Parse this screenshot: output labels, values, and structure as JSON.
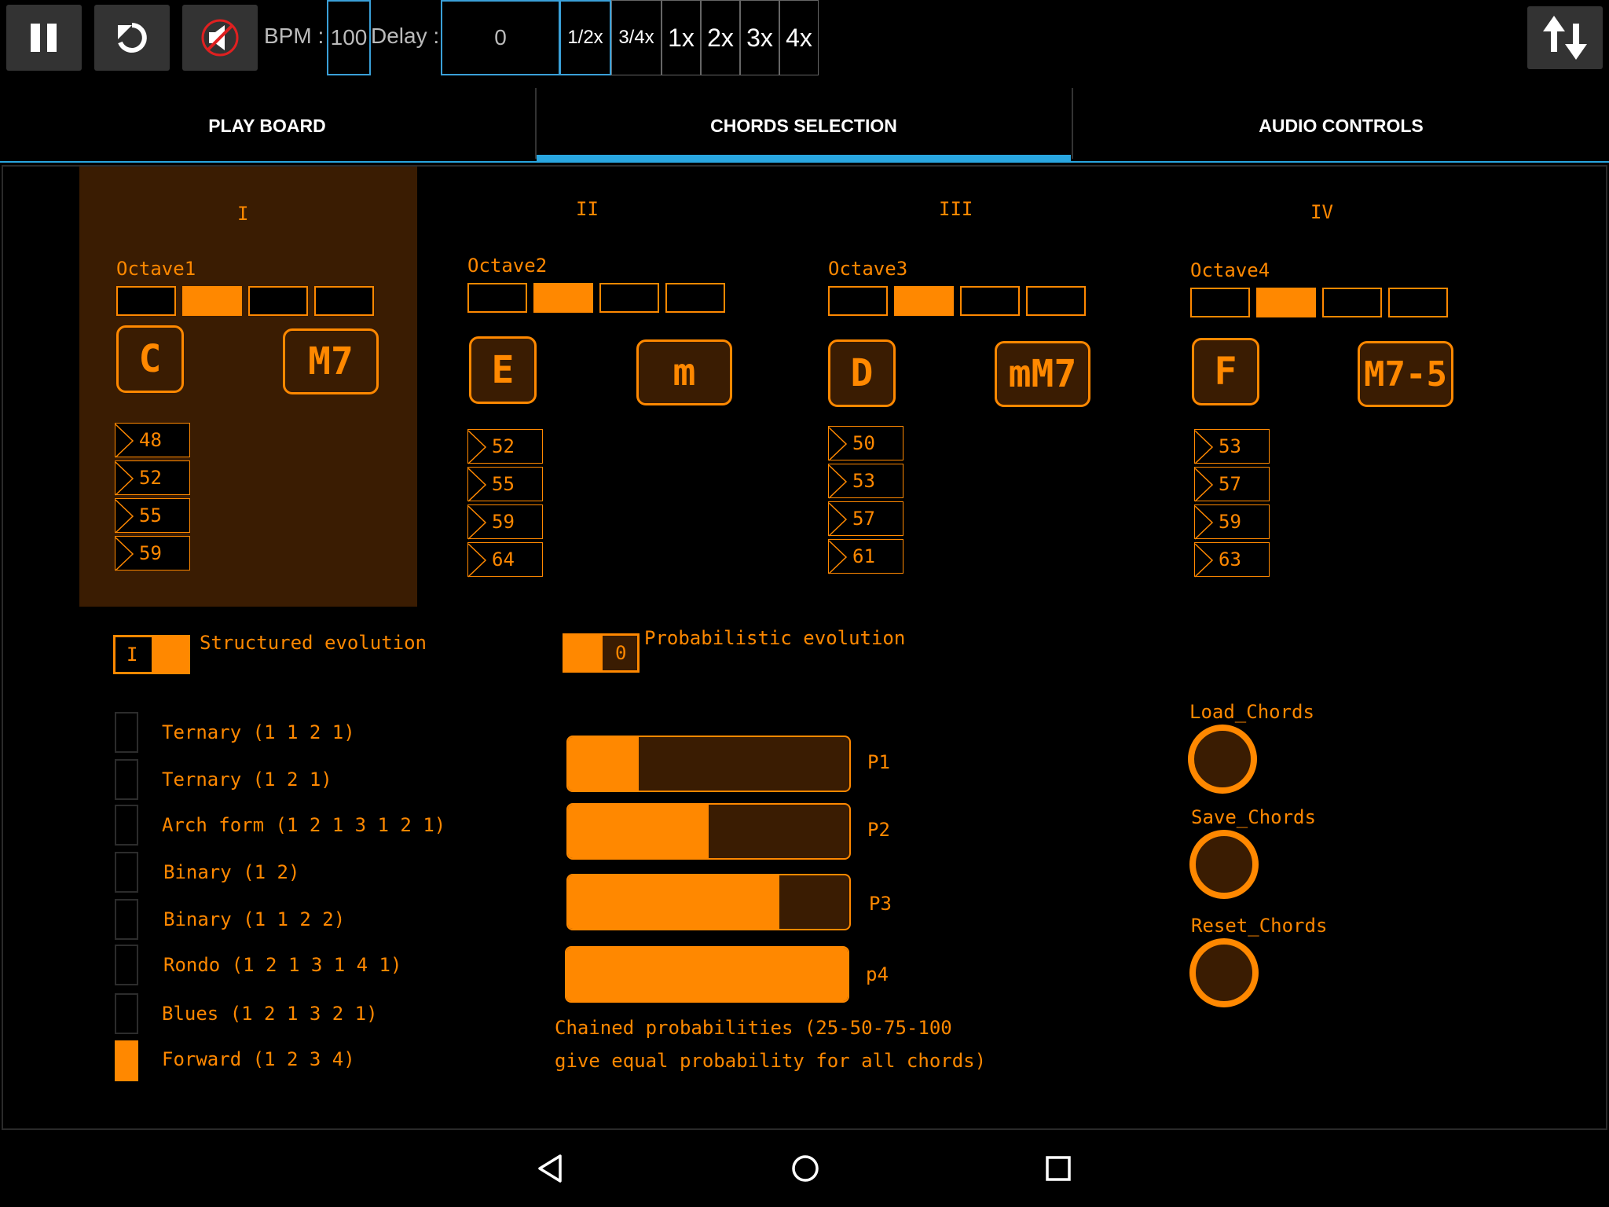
{
  "toolbar": {
    "bpm_label": "BPM :",
    "bpm_value": "100",
    "delay_label": "Delay :",
    "delay_value": "0",
    "speeds": [
      "1/2x",
      "3/4x",
      "1x",
      "2x",
      "3x",
      "4x"
    ],
    "selected_speed": "1/2x"
  },
  "tabs": [
    {
      "label": "PLAY BOARD",
      "active": false
    },
    {
      "label": "CHORDS SELECTION",
      "active": true
    },
    {
      "label": "AUDIO CONTROLS",
      "active": false
    }
  ],
  "chords": [
    {
      "degree": "I",
      "octave_label": "Octave1",
      "octave_selected": 2,
      "root": "C",
      "quality": "M7",
      "notes": [
        "48",
        "52",
        "55",
        "59"
      ],
      "highlighted": true
    },
    {
      "degree": "II",
      "octave_label": "Octave2",
      "octave_selected": 2,
      "root": "E",
      "quality": "m",
      "notes": [
        "52",
        "55",
        "59",
        "64"
      ],
      "highlighted": false
    },
    {
      "degree": "III",
      "octave_label": "Octave3",
      "octave_selected": 2,
      "root": "D",
      "quality": "mM7",
      "notes": [
        "50",
        "53",
        "57",
        "61"
      ],
      "highlighted": false
    },
    {
      "degree": "IV",
      "octave_label": "Octave4",
      "octave_selected": 2,
      "root": "F",
      "quality": "M7-5",
      "notes": [
        "53",
        "57",
        "59",
        "63"
      ],
      "highlighted": false
    }
  ],
  "structured": {
    "toggle_text": "I",
    "toggle_on": true,
    "label": "Structured evolution",
    "forms": [
      {
        "label": "Ternary (1 1 2 1)",
        "checked": false
      },
      {
        "label": "Ternary (1 2 1)",
        "checked": false
      },
      {
        "label": "Arch form (1 2 1 3 1 2 1)",
        "checked": false
      },
      {
        "label": "Binary (1 2)",
        "checked": false
      },
      {
        "label": "Binary (1 1 2 2)",
        "checked": false
      },
      {
        "label": "Rondo (1 2 1 3 1 4 1)",
        "checked": false
      },
      {
        "label": "Blues (1 2 1 3 2 1)",
        "checked": false
      },
      {
        "label": "Forward (1 2 3 4)",
        "checked": true
      }
    ]
  },
  "probabilistic": {
    "toggle_text": "0",
    "toggle_on": false,
    "label": "Probabilistic evolution",
    "sliders": [
      {
        "label": "P1",
        "value": 25
      },
      {
        "label": "P2",
        "value": 50
      },
      {
        "label": "P3",
        "value": 75
      },
      {
        "label": "p4",
        "value": 100
      }
    ],
    "note_line1": "Chained probabilities (25-50-75-100",
    "note_line2": "give equal probability for all chords)"
  },
  "actions": [
    {
      "label": "Load_Chords"
    },
    {
      "label": "Save_Chords"
    },
    {
      "label": "Reset_Chords"
    }
  ],
  "colors": {
    "accent": "#ff8800",
    "accent_dark": "#3a1c02",
    "tab_indicator": "#29a6e0"
  },
  "icons": {
    "pause": "pause-icon",
    "replay": "replay-icon",
    "mute": "mute-icon",
    "swap": "swap-vertical-icon"
  }
}
